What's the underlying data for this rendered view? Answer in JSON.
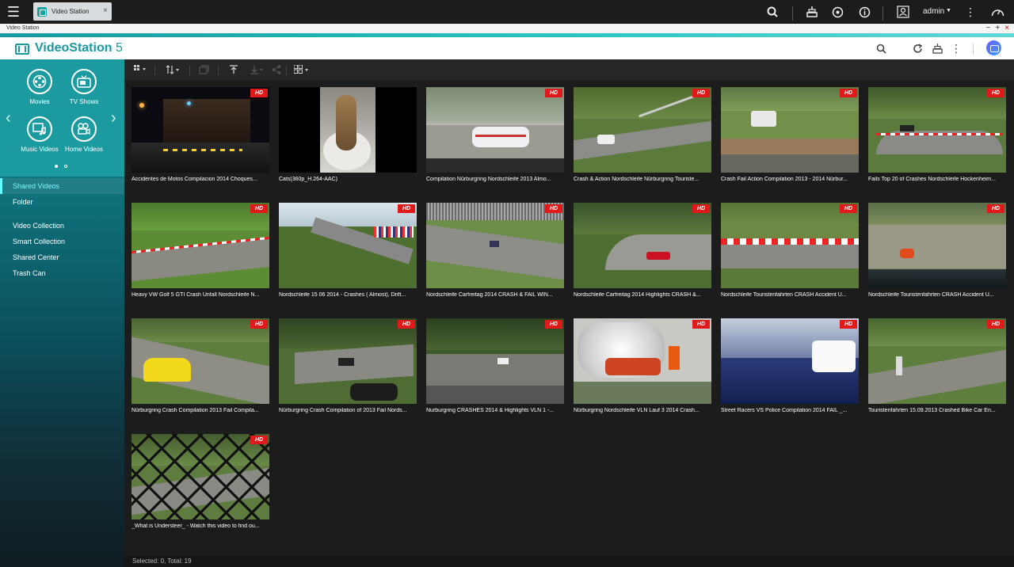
{
  "os": {
    "tab_label": "Video Station",
    "tab_close": "×",
    "user": "admin",
    "user_caret": "▼"
  },
  "window": {
    "title": "Video Station",
    "minimize": "−",
    "maximize": "+",
    "close": "×"
  },
  "app": {
    "name": "VideoStation",
    "version": "5"
  },
  "categories": [
    {
      "label": "Movies",
      "icon": "film-reel-icon"
    },
    {
      "label": "TV Shows",
      "icon": "tv-icon"
    },
    {
      "label": "Music Videos",
      "icon": "music-video-icon"
    },
    {
      "label": "Home Videos",
      "icon": "camera-icon"
    }
  ],
  "nav": [
    {
      "label": "Shared Videos",
      "active": true
    },
    {
      "label": "Folder"
    },
    {
      "label": "Video Collection"
    },
    {
      "label": "Smart Collection"
    },
    {
      "label": "Shared Center"
    },
    {
      "label": "Trash Can"
    }
  ],
  "badge": "HD",
  "videos": [
    {
      "title": "Accidentes de Motos Compilacion 2014 Choques...",
      "hd": true
    },
    {
      "title": "Cats(360p_H.264-AAC)",
      "hd": false
    },
    {
      "title": "Compilation Nürburgring Nordschleife 2013 Almo...",
      "hd": true
    },
    {
      "title": "Crash & Action Nordschleife Nürburgring Touriste...",
      "hd": true
    },
    {
      "title": "Crash Fail Action Compilation 2013 - 2014 Nürbur...",
      "hd": true
    },
    {
      "title": "Fails Top 20 of Crashes Nordschleife Hockenheim...",
      "hd": true
    },
    {
      "title": "Heavy VW Golf 5 GTI Crash Unfall Nordschleife N...",
      "hd": true
    },
    {
      "title": "Nordschleife 15 06 2014 - Crashes ( Almost), Drift...",
      "hd": true
    },
    {
      "title": "Nordschleife Carfreitag 2014 CRASH & FAIL WIN...",
      "hd": true
    },
    {
      "title": "Nordschleife Carfreitag 2014 Highlights CRASH &...",
      "hd": true
    },
    {
      "title": "Nordschleife Touristenfahrten CRASH Accident U...",
      "hd": true
    },
    {
      "title": "Nordschleife Touristenfahrten CRASH Accident U...",
      "hd": true
    },
    {
      "title": "Nürburgring Crash Compilation 2013 Fail Compila...",
      "hd": true
    },
    {
      "title": "Nürburgring Crash Compilation of 2013 Fail Nords...",
      "hd": true
    },
    {
      "title": "Nurburgring CRASHES 2014 & Highlights VLN 1 -...",
      "hd": true
    },
    {
      "title": "Nürburgring Nordschleife VLN Lauf 3 2014 Crash...",
      "hd": true
    },
    {
      "title": "Street Racers VS Police Compilation 2014 FAIL _...",
      "hd": true
    },
    {
      "title": "Touristenfahrten 15.09.2013 Crashed Bike Car En...",
      "hd": true
    },
    {
      "title": "_What is Understeer_ - Watch this video to find ou...",
      "hd": true
    }
  ],
  "status": "Selected: 0, Total: 19"
}
